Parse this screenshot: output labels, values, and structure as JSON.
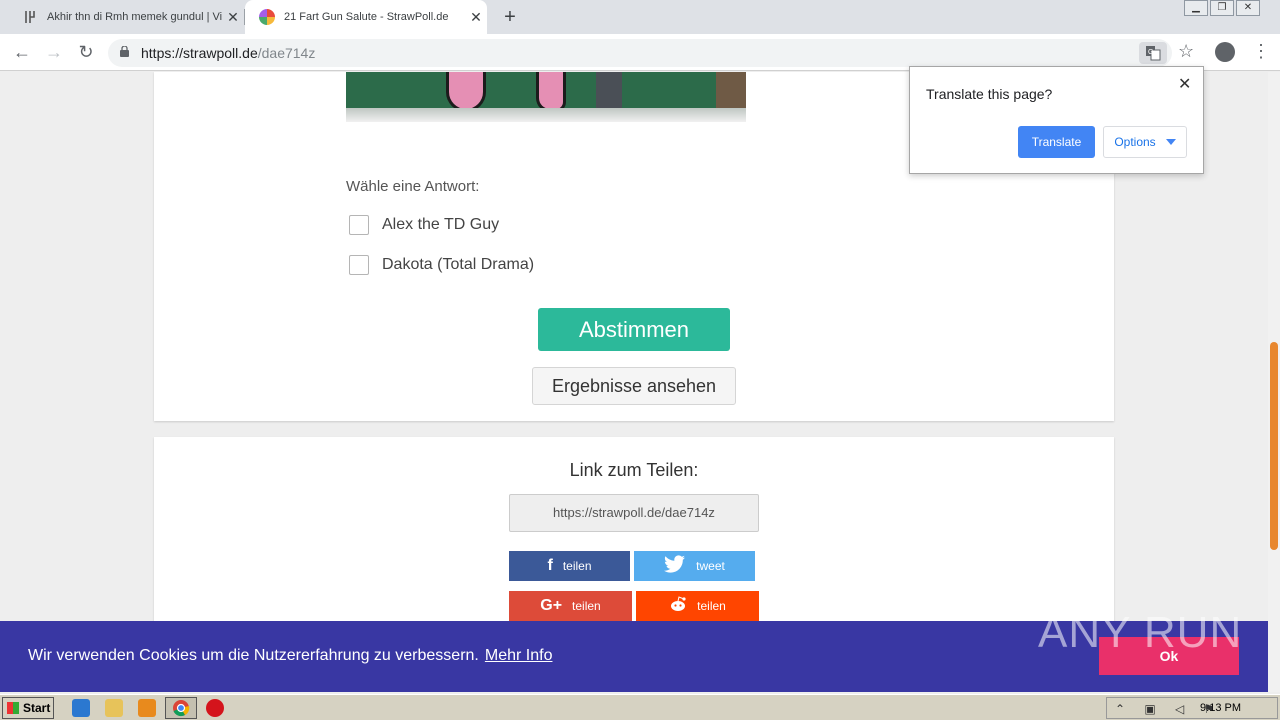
{
  "browser": {
    "tabs": [
      {
        "title": "Akhir thn di Rmh memek gundul | Vid",
        "active": false
      },
      {
        "title": "21 Fart Gun Salute - StrawPoll.de",
        "active": true
      }
    ],
    "url_host": "https://strawpoll.de",
    "url_path": "/dae714z"
  },
  "translate_popup": {
    "title": "Translate this page?",
    "translate_label": "Translate",
    "options_label": "Options"
  },
  "poll": {
    "question": "Wähle eine Antwort:",
    "options": [
      {
        "label": "Alex the TD Guy"
      },
      {
        "label": "Dakota (Total Drama)"
      }
    ],
    "vote_label": "Abstimmen",
    "results_label": "Ergebnisse ansehen"
  },
  "share": {
    "title": "Link zum Teilen:",
    "link": "https://strawpoll.de/dae714z",
    "facebook_label": "teilen",
    "twitter_label": "tweet",
    "googleplus_label": "teilen",
    "reddit_label": "teilen"
  },
  "cookie": {
    "text": "Wir verwenden Cookies um die Nutzererfahrung zu verbessern.",
    "more_label": "Mehr Info",
    "ok_label": "Ok"
  },
  "watermark": "ANY RUN",
  "taskbar": {
    "start_label": "Start",
    "clock": "9:13 PM"
  },
  "colors": {
    "vote_button": "#2cb99a",
    "cookie_bar": "#3937a3",
    "facebook": "#3b5998",
    "twitter": "#55acee",
    "googleplus": "#dd4b39",
    "reddit": "#ff4500",
    "translate_button": "#4285f4",
    "scroll_thumb": "#e8872e"
  }
}
